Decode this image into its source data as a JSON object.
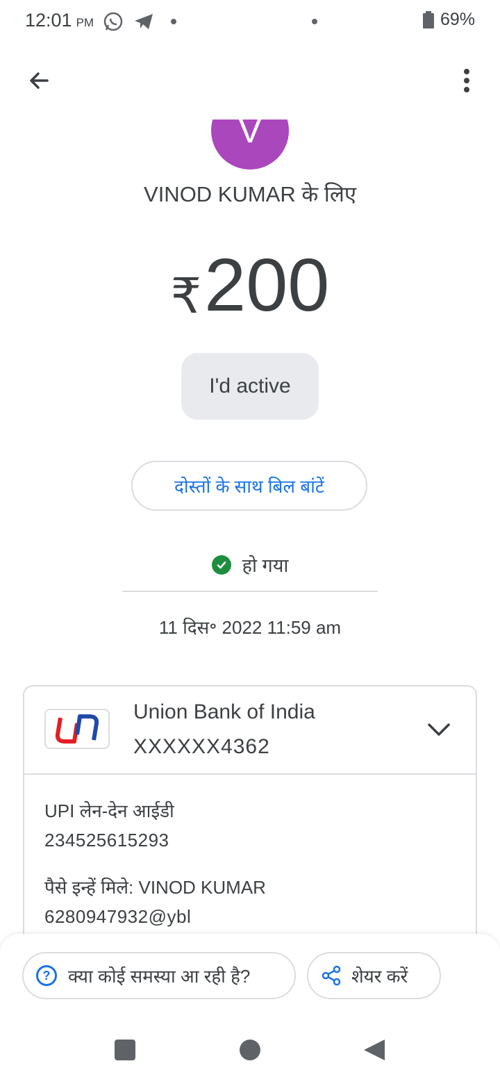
{
  "status_bar": {
    "time": "12:01",
    "ampm": "PM",
    "battery": "69%",
    "icons": [
      "whatsapp-icon",
      "telegram-icon",
      "battery-icon"
    ]
  },
  "app_bar": {
    "back_icon": "arrow-back-icon",
    "menu_icon": "more-vert-icon"
  },
  "avatar": {
    "initial": "V",
    "color": "#ab47bc"
  },
  "payee_line": "VINOD KUMAR के लिए",
  "amount": {
    "currency": "₹",
    "value": "200"
  },
  "note": "I'd active",
  "split_button": "दोस्तों के साथ बिल बांटें",
  "status": {
    "text": "हो गया",
    "icon": "check-circle-icon",
    "color": "#1e8e3e"
  },
  "datetime": "11 दिस॰ 2022 11:59 am",
  "bank": {
    "name": "Union Bank of India",
    "account": "XXXXXX4362",
    "expand_icon": "chevron-down-icon"
  },
  "details": {
    "upi_label": "UPI लेन-देन आईडी",
    "upi_id": "234525615293",
    "recipient_label": "पैसे इन्हें मिले: VINOD KUMAR",
    "recipient_upi": "6280947932@ybl"
  },
  "actions": {
    "help_label": "क्या कोई समस्या आ रही है?",
    "share_label": "शेयर करें"
  },
  "accent_color": "#1a73e8"
}
